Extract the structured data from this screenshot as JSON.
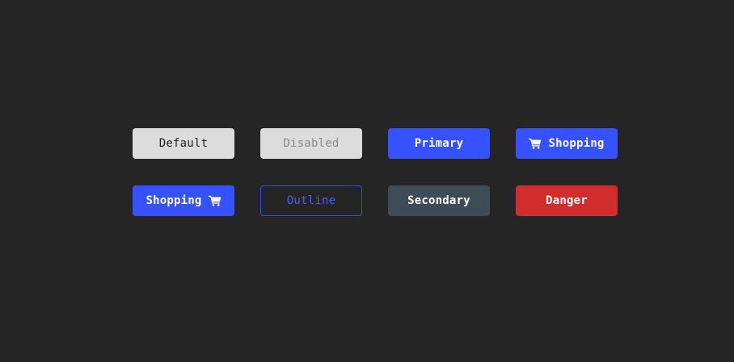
{
  "buttons": {
    "default": {
      "label": "Default"
    },
    "disabled": {
      "label": "Disabled"
    },
    "primary": {
      "label": "Primary"
    },
    "shopping_icon_left": {
      "label": "Shopping",
      "icon": "shopping-cart-icon"
    },
    "shopping_icon_right": {
      "label": "Shopping",
      "icon": "shopping-cart-icon"
    },
    "outline": {
      "label": "Outline"
    },
    "secondary": {
      "label": "Secondary"
    },
    "danger": {
      "label": "Danger"
    }
  },
  "colors": {
    "background": "#252525",
    "primary": "#3652ff",
    "default": "#dcdcdc",
    "secondary": "#3e4c56",
    "danger": "#d22d2d",
    "outline": "#3a4bf0"
  }
}
